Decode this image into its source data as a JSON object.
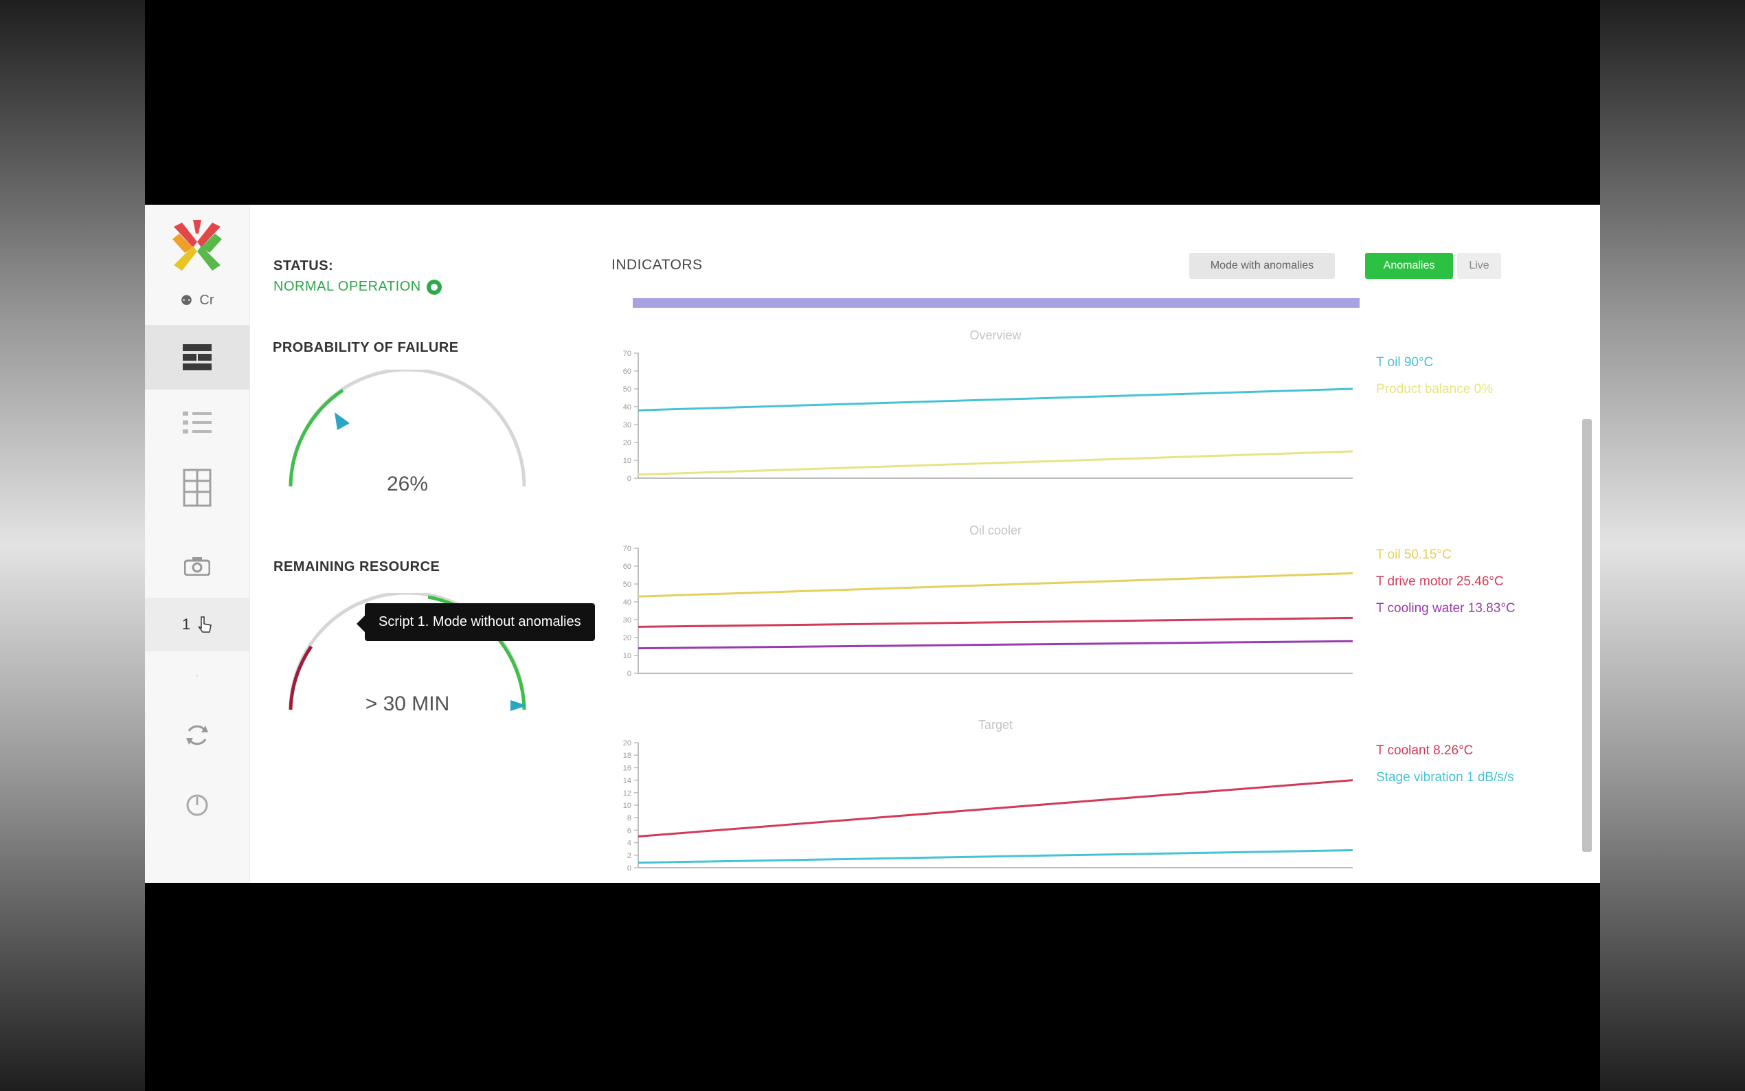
{
  "sidebar": {
    "user_label": "Cr",
    "tooltip": "Script 1. Mode without anomalies",
    "script_number": "1"
  },
  "status": {
    "heading": "STATUS:",
    "value": "NORMAL OPERATION"
  },
  "failure": {
    "heading": "PROBABILITY OF FAILURE",
    "value_text": "26%",
    "value": 26
  },
  "resources": {
    "heading": "REMAINING RESOURCE",
    "value_text": "> 30 MIN"
  },
  "indicators": {
    "heading": "INDICATORS",
    "btn_grey": "Mode with anomalies",
    "btn_green": "Anomalies",
    "btn_light": "Live",
    "progress": 1.0
  },
  "colors": {
    "cyan": "#45c3d6",
    "yellow": "#e6e483",
    "orange_yellow": "#e6cf5a",
    "red": "#d23a58",
    "purple": "#9a3ab0",
    "green": "#2dc144"
  },
  "charts": [
    {
      "title": "Overview",
      "legend": [
        "T oil 90°C",
        "Product balance 0%"
      ],
      "legend_colors": [
        "#45c3d6",
        "#e6e483"
      ],
      "yticks": [
        "0",
        "10",
        "20",
        "30",
        "40",
        "50",
        "60",
        "70"
      ]
    },
    {
      "title": "Oil cooler",
      "legend": [
        "T oil 50.15°C",
        "T drive motor 25.46°C",
        "T cooling water 13.83°C"
      ],
      "legend_colors": [
        "#e6cf5a",
        "#d23a58",
        "#9a3ab0"
      ],
      "yticks": [
        "0",
        "10",
        "20",
        "30",
        "40",
        "50",
        "60",
        "70"
      ]
    },
    {
      "title": "Target",
      "legend": [
        "T coolant 8.26°C",
        "Stage vibration 1 dB/s/s"
      ],
      "legend_colors": [
        "#d23a58",
        "#45c3d6"
      ],
      "yticks": [
        "0",
        "2",
        "4",
        "6",
        "8",
        "10",
        "12",
        "14",
        "16",
        "18",
        "20"
      ]
    }
  ],
  "chart_data": [
    {
      "type": "line",
      "title": "Overview",
      "x": [
        0,
        1
      ],
      "ylim": [
        0,
        70
      ],
      "series": [
        {
          "name": "T oil 90°C",
          "values": [
            38,
            50
          ],
          "color": "#45c3d6"
        },
        {
          "name": "Product balance 0%",
          "values": [
            2,
            15
          ],
          "color": "#e6e483"
        }
      ]
    },
    {
      "type": "line",
      "title": "Oil cooler",
      "x": [
        0,
        1
      ],
      "ylim": [
        0,
        70
      ],
      "series": [
        {
          "name": "T oil 50.15°C",
          "values": [
            43,
            56
          ],
          "color": "#e6cf5a"
        },
        {
          "name": "T drive motor 25.46°C",
          "values": [
            26,
            31
          ],
          "color": "#d23a58"
        },
        {
          "name": "T cooling water 13.83°C",
          "values": [
            14,
            18
          ],
          "color": "#9a3ab0"
        }
      ]
    },
    {
      "type": "line",
      "title": "Target",
      "x": [
        0,
        1
      ],
      "ylim": [
        0,
        20
      ],
      "series": [
        {
          "name": "T coolant 8.26°C",
          "values": [
            5,
            14
          ],
          "color": "#d23a58"
        },
        {
          "name": "Stage vibration 1 dB/s/s",
          "values": [
            0.8,
            2.8
          ],
          "color": "#45c3d6"
        }
      ]
    }
  ]
}
